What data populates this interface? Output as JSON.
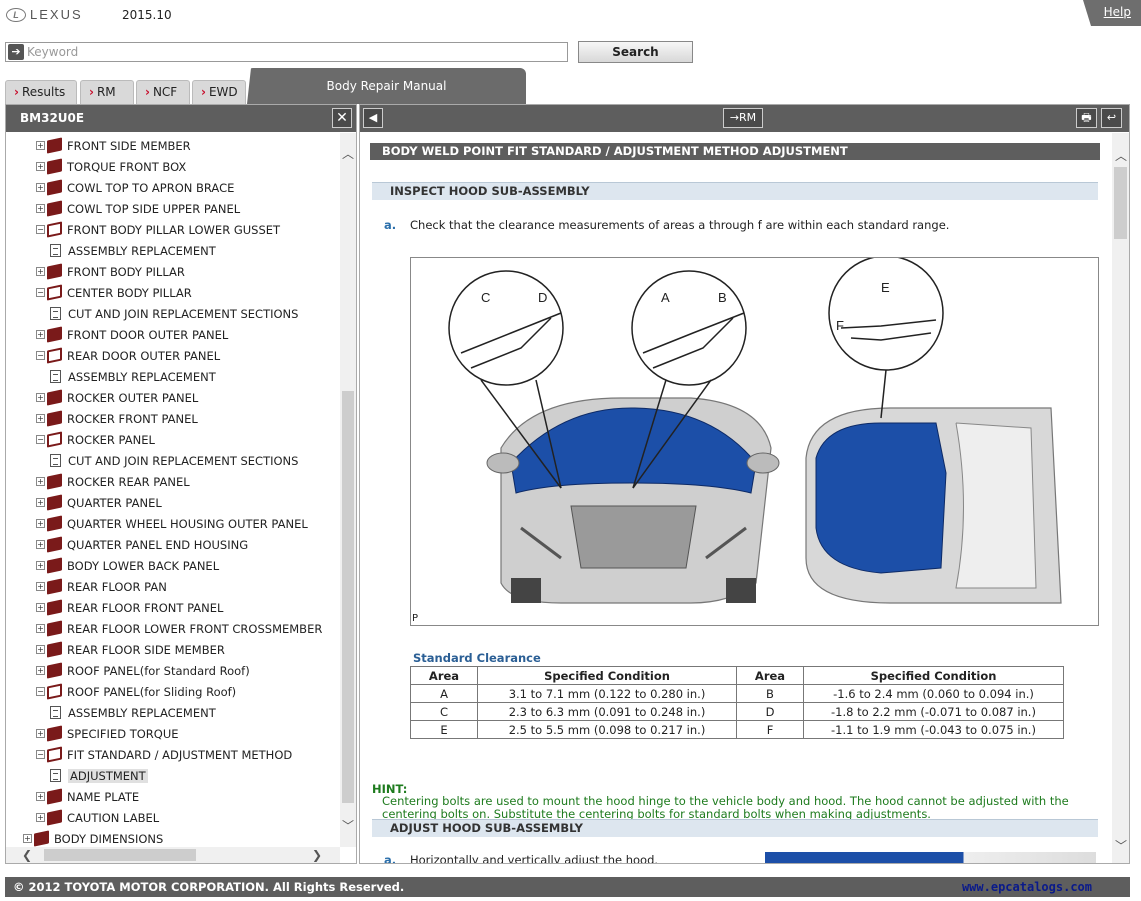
{
  "header": {
    "brand": "LEXUS",
    "version": "2015.10",
    "help": "Help"
  },
  "search": {
    "placeholder": "Keyword",
    "button": "Search"
  },
  "tabs": [
    {
      "label": "Results"
    },
    {
      "label": "RM"
    },
    {
      "label": "NCF"
    },
    {
      "label": "EWD"
    }
  ],
  "active_tab": "Body Repair Manual",
  "left_panel": {
    "title": "BM32U0E",
    "close": "✕",
    "tree": [
      {
        "label": "FRONT SIDE MEMBER",
        "type": "book",
        "exp": "+"
      },
      {
        "label": "TORQUE FRONT BOX",
        "type": "book",
        "exp": "+"
      },
      {
        "label": "COWL TOP TO APRON BRACE",
        "type": "book",
        "exp": "+"
      },
      {
        "label": "COWL TOP SIDE UPPER PANEL",
        "type": "book",
        "exp": "+"
      },
      {
        "label": "FRONT BODY PILLAR LOWER GUSSET",
        "type": "open",
        "exp": "−"
      },
      {
        "label": "ASSEMBLY REPLACEMENT",
        "type": "doc",
        "exp": ""
      },
      {
        "label": "FRONT BODY PILLAR",
        "type": "book",
        "exp": "+"
      },
      {
        "label": "CENTER BODY PILLAR",
        "type": "open",
        "exp": "−"
      },
      {
        "label": "CUT AND JOIN REPLACEMENT SECTIONS",
        "type": "doc",
        "exp": ""
      },
      {
        "label": "FRONT DOOR OUTER PANEL",
        "type": "book",
        "exp": "+"
      },
      {
        "label": "REAR DOOR OUTER PANEL",
        "type": "open",
        "exp": "−"
      },
      {
        "label": "ASSEMBLY REPLACEMENT",
        "type": "doc",
        "exp": ""
      },
      {
        "label": "ROCKER OUTER PANEL",
        "type": "book",
        "exp": "+"
      },
      {
        "label": "ROCKER FRONT PANEL",
        "type": "book",
        "exp": "+"
      },
      {
        "label": "ROCKER PANEL",
        "type": "open",
        "exp": "−"
      },
      {
        "label": "CUT AND JOIN REPLACEMENT SECTIONS",
        "type": "doc",
        "exp": ""
      },
      {
        "label": "ROCKER REAR PANEL",
        "type": "book",
        "exp": "+"
      },
      {
        "label": "QUARTER PANEL",
        "type": "book",
        "exp": "+"
      },
      {
        "label": "QUARTER WHEEL HOUSING OUTER PANEL",
        "type": "book",
        "exp": "+"
      },
      {
        "label": "QUARTER PANEL END HOUSING",
        "type": "book",
        "exp": "+"
      },
      {
        "label": "BODY LOWER BACK PANEL",
        "type": "book",
        "exp": "+"
      },
      {
        "label": "REAR FLOOR PAN",
        "type": "book",
        "exp": "+"
      },
      {
        "label": "REAR FLOOR FRONT PANEL",
        "type": "book",
        "exp": "+"
      },
      {
        "label": "REAR FLOOR LOWER FRONT CROSSMEMBER",
        "type": "book",
        "exp": "+"
      },
      {
        "label": "REAR FLOOR SIDE MEMBER",
        "type": "book",
        "exp": "+"
      },
      {
        "label": "ROOF PANEL(for Standard Roof)",
        "type": "book",
        "exp": "+"
      },
      {
        "label": "ROOF PANEL(for Sliding Roof)",
        "type": "open",
        "exp": "−"
      },
      {
        "label": "ASSEMBLY REPLACEMENT",
        "type": "doc",
        "exp": ""
      },
      {
        "label": "SPECIFIED TORQUE",
        "type": "book",
        "exp": "+"
      },
      {
        "label": "FIT STANDARD / ADJUSTMENT METHOD",
        "type": "open",
        "exp": "−"
      },
      {
        "label": "ADJUSTMENT",
        "type": "doc",
        "exp": "",
        "selected": true
      },
      {
        "label": "NAME PLATE",
        "type": "book",
        "exp": "+"
      },
      {
        "label": "CAUTION LABEL",
        "type": "book",
        "exp": "+"
      },
      {
        "label": "BODY DIMENSIONS",
        "type": "book",
        "exp": "+",
        "level0": true
      }
    ]
  },
  "toolbar": {
    "back": "◀",
    "rm": "→RM",
    "print": "🖶",
    "return": "↩"
  },
  "content": {
    "section_title": "BODY WELD POINT  FIT STANDARD / ADJUSTMENT METHOD  ADJUSTMENT",
    "inspect_title": "INSPECT HOOD SUB-ASSEMBLY",
    "step_a": "a.",
    "inspect_text": "Check that the clearance measurements of areas a through f are within each standard range.",
    "figure_letters": [
      "C",
      "D",
      "A",
      "B",
      "E",
      "F"
    ],
    "figure_label": "P",
    "std_title": "Standard Clearance",
    "table_headers": [
      "Area",
      "Specified Condition",
      "Area",
      "Specified Condition"
    ],
    "table_rows": [
      [
        "A",
        "3.1 to 7.1 mm (0.122 to 0.280 in.)",
        "B",
        "-1.6 to 2.4 mm (0.060 to 0.094 in.)"
      ],
      [
        "C",
        "2.3 to 6.3 mm (0.091 to 0.248 in.)",
        "D",
        "-1.8 to 2.2 mm (-0.071 to 0.087 in.)"
      ],
      [
        "E",
        "2.5 to 5.5 mm (0.098 to 0.217 in.)",
        "F",
        "-1.1 to 1.9 mm (-0.043 to 0.075 in.)"
      ]
    ],
    "hint_label": "HINT:",
    "hint_text": "Centering bolts are used to mount the hood hinge to the vehicle body and hood. The hood cannot be adjusted with the centering bolts on. Substitute the centering bolts for standard bolts when making adjustments.",
    "adjust_title": "ADJUST HOOD SUB-ASSEMBLY",
    "adjust_step": "a.",
    "adjust_text": "Horizontally and vertically adjust the hood."
  },
  "footer": {
    "copyright": "© 2012 TOYOTA MOTOR CORPORATION. All Rights Reserved.",
    "url": "www.epcatalogs.com"
  },
  "colors": {
    "toolbar": "#5e5e5e",
    "accent_red": "#c8102e",
    "hint_green": "#1e7b1e",
    "hood_blue": "#1c4fa8"
  }
}
